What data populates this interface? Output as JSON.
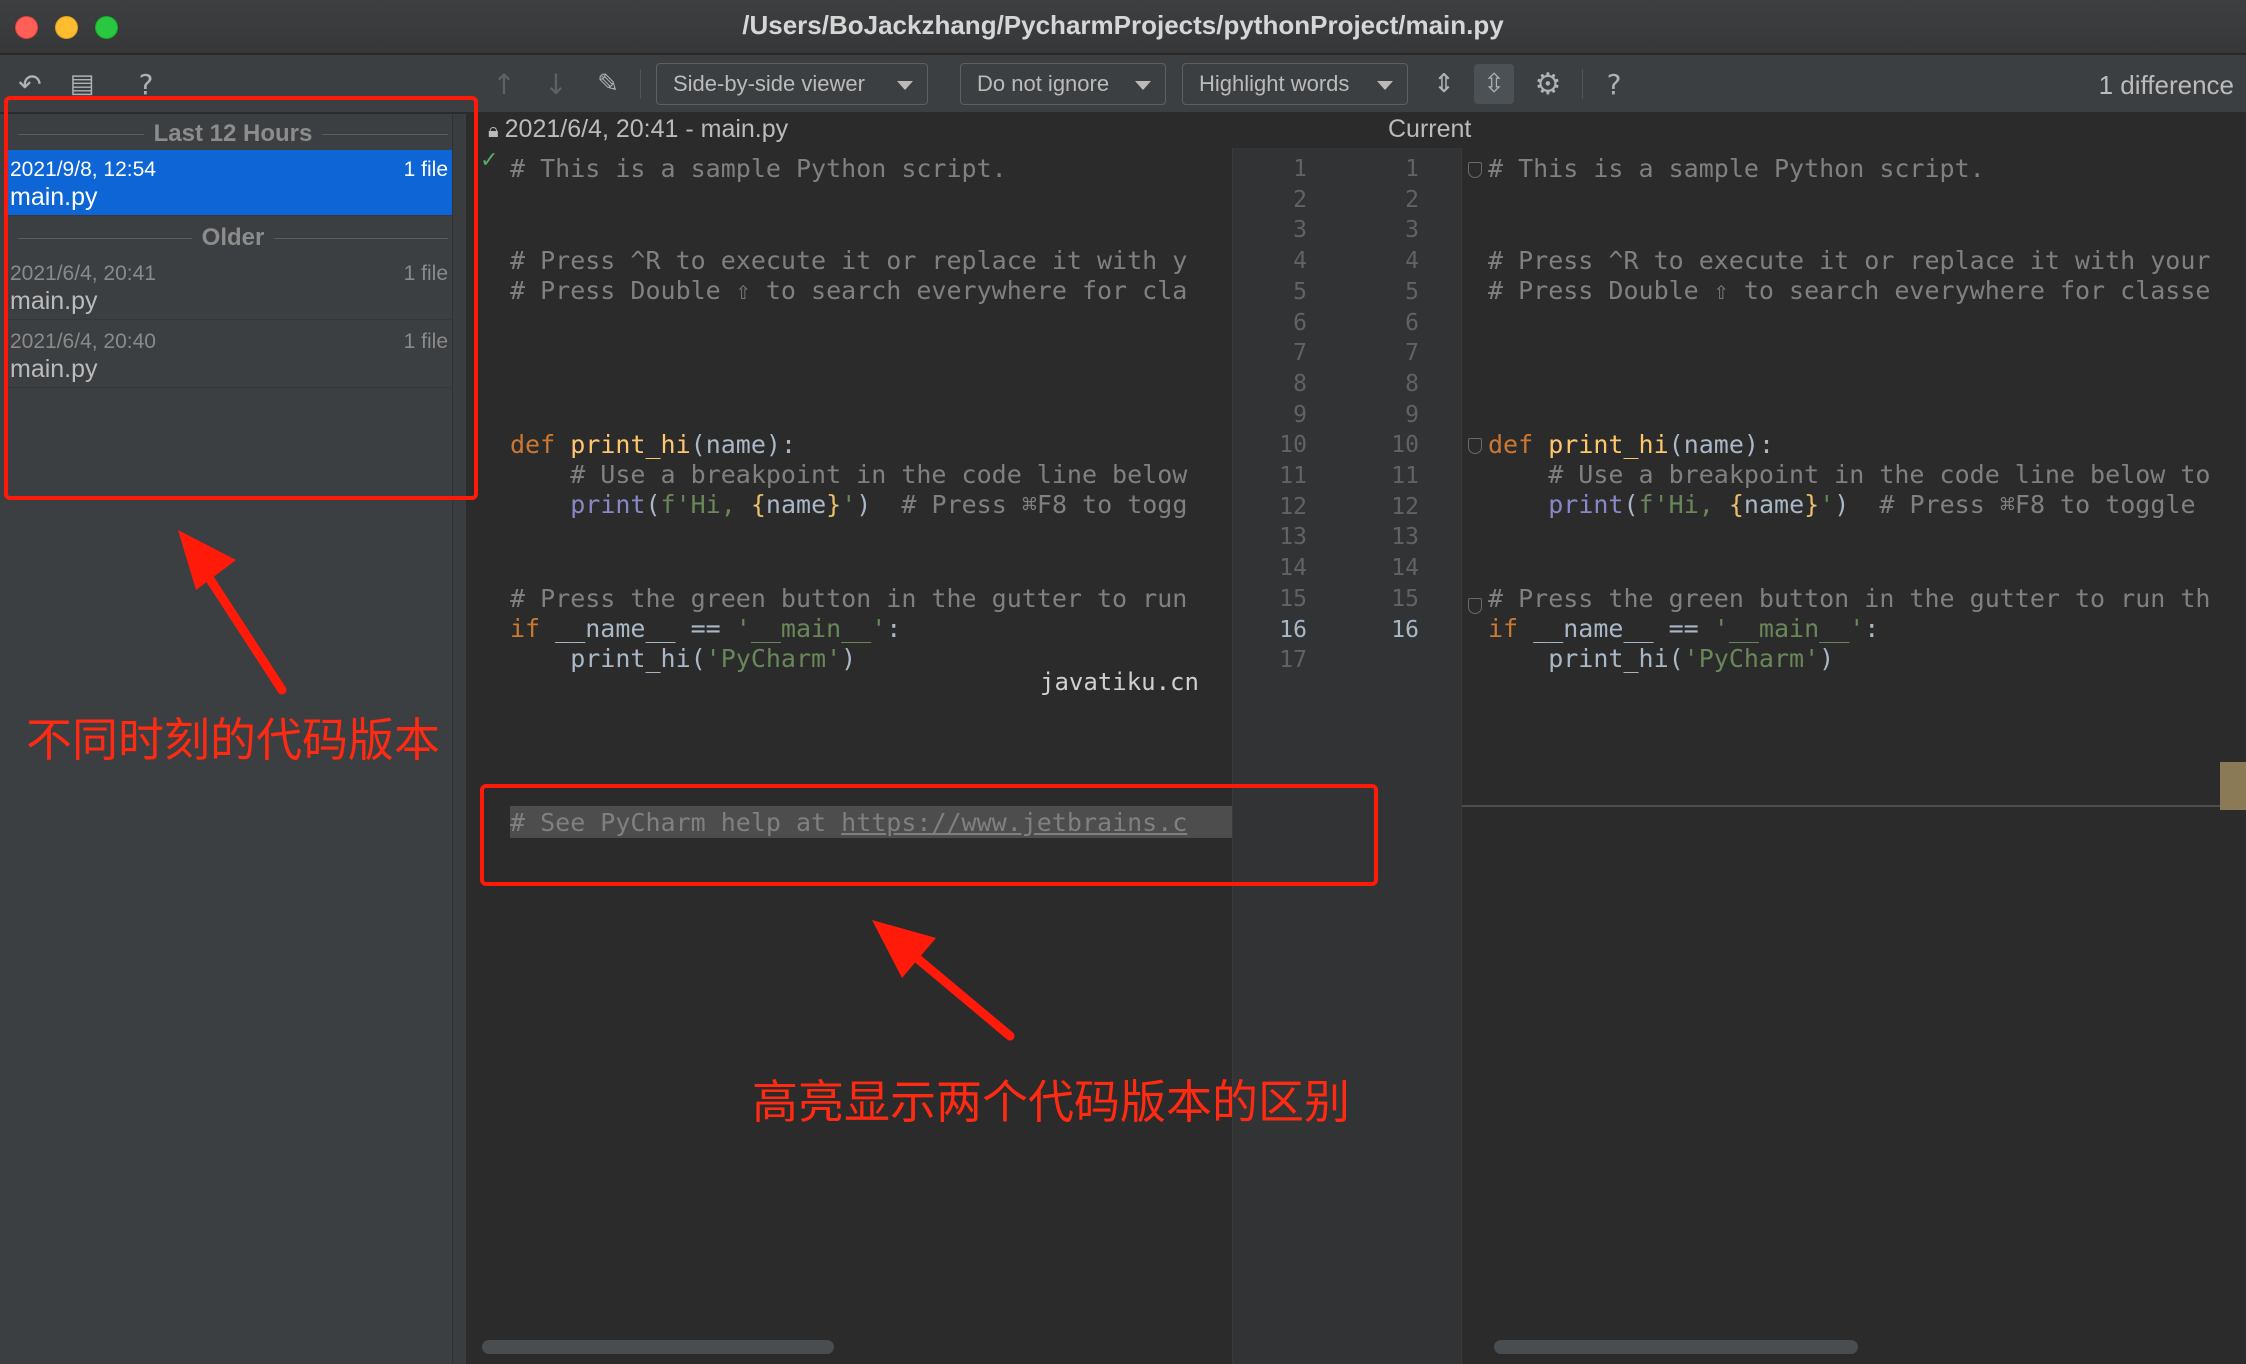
{
  "window": {
    "title": "/Users/BoJackzhang/PycharmProjects/pythonProject/main.py"
  },
  "toolbar": {
    "viewer_mode": "Side-by-side viewer",
    "ignore_mode": "Do not ignore",
    "highlight_mode": "Highlight words",
    "difference_count": "1 difference",
    "help_label": "?",
    "icons": [
      "revert-icon",
      "file-icon",
      "help-icon",
      "prev-diff-icon",
      "next-diff-icon",
      "edit-icon",
      "collapse-icon",
      "sync-scroll-icon",
      "settings-icon",
      "help-icon"
    ]
  },
  "history": {
    "groups": [
      {
        "label": "Last 12 Hours",
        "items": [
          {
            "date": "2021/9/8, 12:54",
            "files": "1 file",
            "name": "main.py",
            "selected": true
          }
        ]
      },
      {
        "label": "Older",
        "items": [
          {
            "date": "2021/6/4, 20:41",
            "files": "1 file",
            "name": "main.py"
          },
          {
            "date": "2021/6/4, 20:40",
            "files": "1 file",
            "name": "main.py"
          }
        ]
      }
    ]
  },
  "diff": {
    "left_title": "2021/6/4, 20:41 - main.py",
    "right_title": "Current",
    "left_line_numbers": [
      "1",
      "2",
      "3",
      "4",
      "5",
      "6",
      "7",
      "8",
      "9",
      "10",
      "11",
      "12",
      "13",
      "14",
      "15",
      "16",
      "17"
    ],
    "right_line_numbers": [
      "1",
      "2",
      "3",
      "4",
      "5",
      "6",
      "7",
      "8",
      "9",
      "10",
      "11",
      "12",
      "13",
      "14",
      "15",
      "16"
    ],
    "left_lines": {
      "l1": "# This is a sample Python script.",
      "l3": "# Press ^R to execute it or replace it with y",
      "l4": "# Press Double ⇧ to search everywhere for cla",
      "l7_def": "def ",
      "l7_fn": "print_hi",
      "l7_rest": "(name):",
      "l8": "    # Use a breakpoint in the code line below",
      "l9_pre": "    ",
      "l9_print": "print",
      "l9_a": "(",
      "l9_str1": "f'Hi, ",
      "l9_br1": "{",
      "l9_name": "name",
      "l9_br2": "}",
      "l9_str2": "'",
      "l9_b": ")",
      "l9_cm": "  # Press ⌘F8 to togg",
      "l12": "# Press the green button in the gutter to run",
      "l13_if": "if ",
      "l13_mid": "__name__ == ",
      "l13_str": "'__main__'",
      "l13_end": ":",
      "l14_pre": "    print_hi(",
      "l14_str": "'PyCharm'",
      "l14_end": ")",
      "l16_pre": "# See PyCharm help at ",
      "l16_link": "https://www.jetbrains.c"
    },
    "right_lines": {
      "l1": "# This is a sample Python script.",
      "l3": "# Press ^R to execute it or replace it with your",
      "l4": "# Press Double ⇧ to search everywhere for classe",
      "l7_def": "def ",
      "l7_fn": "print_hi",
      "l7_rest": "(name):",
      "l8": "    # Use a breakpoint in the code line below to",
      "l9_pre": "    ",
      "l9_print": "print",
      "l9_a": "(",
      "l9_str1": "f'Hi, ",
      "l9_br1": "{",
      "l9_name": "name",
      "l9_br2": "}",
      "l9_str2": "'",
      "l9_b": ")",
      "l9_cm": "  # Press ⌘F8 to toggle",
      "l12": "# Press the green button in the gutter to run th",
      "l13_if": "if ",
      "l13_mid": "__name__ == ",
      "l13_str": "'__main__'",
      "l13_end": ":",
      "l14_pre": "    print_hi(",
      "l14_str": "'PyCharm'",
      "l14_end": ")"
    }
  },
  "watermark": "javatiku.cn",
  "annotations": {
    "history_note": "不同时刻的代码版本",
    "diff_note": "高亮显示两个代码版本的区别",
    "color": "#ff1a0a"
  },
  "colors": {
    "selection": "#0d65d6",
    "keyword": "#cc7832",
    "function": "#ffc66d",
    "string": "#6a8759",
    "comment": "#808080"
  }
}
